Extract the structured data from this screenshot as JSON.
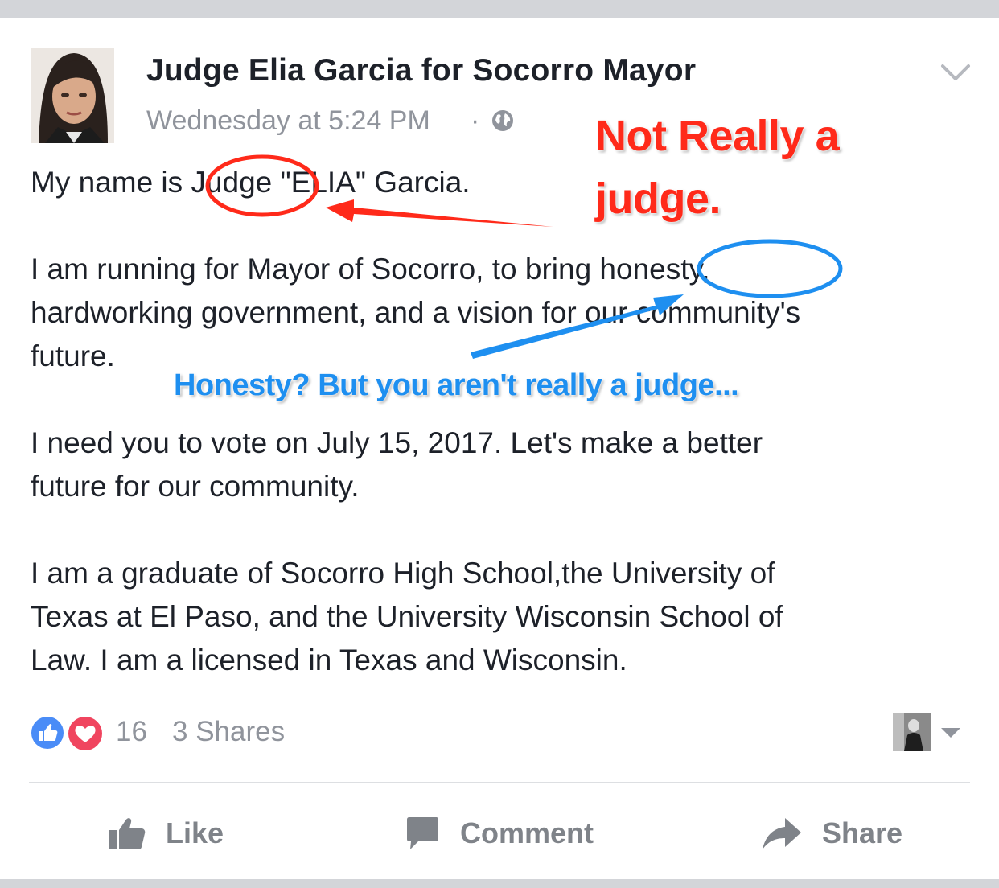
{
  "post": {
    "author": "Judge Elia Garcia for Socorro Mayor",
    "timestamp": "Wednesday at 5:24 PM",
    "separator": "·",
    "privacy_icon": "globe-icon",
    "menu_icon": "chevron-down-icon",
    "lines": [
      "My name is Judge \"ELIA\" Garcia.",
      "I am running for Mayor of Socorro, to bring honesty,",
      "hardworking government, and a vision for our community's",
      "future.",
      "I need you to vote on July 15, 2017.  Let's make a better",
      "future for our community.",
      "I am a graduate of Socorro High School,the University of",
      "Texas at El Paso, and the University Wisconsin School of",
      "Law.  I am a licensed in Texas and Wisconsin."
    ]
  },
  "annotations": {
    "red_line1": "Not Really a",
    "red_line2": "judge.",
    "blue": "Honesty? But you aren't really a judge...",
    "colors": {
      "red": "#ff2a1a",
      "blue": "#1e8ff0"
    }
  },
  "reactions": {
    "icons": [
      "like-icon",
      "love-icon"
    ],
    "count": "16",
    "shares": "3 Shares"
  },
  "actions": {
    "like": "Like",
    "comment": "Comment",
    "share": "Share"
  },
  "colors": {
    "accent": "#4a8cf7",
    "love": "#f0455f",
    "meta": "#90949c",
    "action": "#7f8389"
  }
}
